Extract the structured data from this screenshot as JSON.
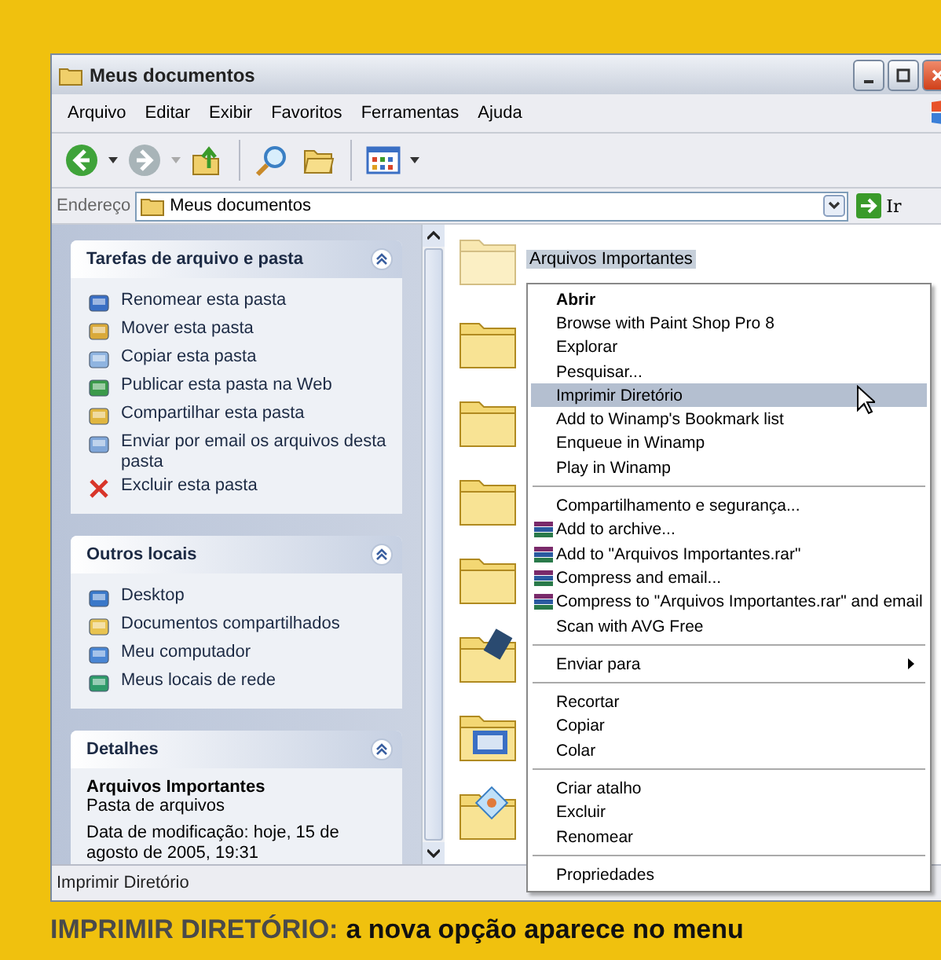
{
  "window": {
    "title": "Meus documentos"
  },
  "menu_bar": [
    "Arquivo",
    "Editar",
    "Exibir",
    "Favoritos",
    "Ferramentas",
    "Ajuda"
  ],
  "address_bar": {
    "label": "Endereço",
    "value": "Meus documentos",
    "go_button": "Ir"
  },
  "task_panels": [
    {
      "title": "Tarefas de arquivo e pasta",
      "items": [
        {
          "label": "Renomear esta pasta",
          "kind": "rename"
        },
        {
          "label": "Mover esta pasta",
          "kind": "move"
        },
        {
          "label": "Copiar esta pasta",
          "kind": "copy"
        },
        {
          "label": "Publicar esta pasta na Web",
          "kind": "globe"
        },
        {
          "label": "Compartilhar esta pasta",
          "kind": "share"
        },
        {
          "label": "Enviar por email os arquivos desta pasta",
          "kind": "mail"
        },
        {
          "label": "Excluir esta pasta",
          "kind": "delete"
        }
      ]
    },
    {
      "title": "Outros locais",
      "items": [
        {
          "label": "Desktop",
          "kind": "desktop"
        },
        {
          "label": "Documentos compartilhados",
          "kind": "folder"
        },
        {
          "label": "Meu computador",
          "kind": "computer"
        },
        {
          "label": "Meus locais de rede",
          "kind": "network"
        }
      ]
    },
    {
      "title": "Detalhes",
      "name": "Arquivos Importantes",
      "type": "Pasta de arquivos",
      "modified": "Data de modificação: hoje, 15 de agosto de 2005, 19:31"
    }
  ],
  "folders": [
    {
      "label": "Arquivos Importantes",
      "selected": true,
      "kind": "plain"
    },
    {
      "selected": false,
      "kind": "plain"
    },
    {
      "selected": false,
      "kind": "plain"
    },
    {
      "selected": false,
      "kind": "plain"
    },
    {
      "selected": false,
      "kind": "plain"
    },
    {
      "selected": false,
      "kind": "video"
    },
    {
      "selected": false,
      "kind": "program"
    },
    {
      "selected": false,
      "kind": "picture"
    }
  ],
  "context_menu": [
    [
      {
        "label": "Abrir",
        "kind": "default",
        "selected": false
      },
      {
        "label": "Browse with Paint Shop Pro 8",
        "kind": "item",
        "selected": false
      },
      {
        "label": "Explorar",
        "kind": "item",
        "selected": false
      },
      {
        "label": "Pesquisar...",
        "kind": "item",
        "selected": false
      },
      {
        "label": "Imprimir Diretório",
        "kind": "item",
        "selected": true
      },
      {
        "label": "Add to Winamp's Bookmark list",
        "kind": "item",
        "selected": false
      },
      {
        "label": "Enqueue in Winamp",
        "kind": "item",
        "selected": false
      },
      {
        "label": "Play in Winamp",
        "kind": "item",
        "selected": false
      }
    ],
    [
      {
        "label": "Compartilhamento e segurança...",
        "kind": "item",
        "selected": false
      },
      {
        "label": "Add to archive...",
        "kind": "archive",
        "selected": false
      },
      {
        "label": "Add to \"Arquivos Importantes.rar\"",
        "kind": "archive",
        "selected": false
      },
      {
        "label": "Compress and email...",
        "kind": "archive",
        "selected": false
      },
      {
        "label": "Compress to \"Arquivos Importantes.rar\" and email",
        "kind": "archive",
        "selected": false
      },
      {
        "label": "Scan with AVG Free",
        "kind": "item",
        "selected": false
      }
    ],
    [
      {
        "label": "Enviar para",
        "kind": "submenu",
        "selected": false
      }
    ],
    [
      {
        "label": "Recortar",
        "kind": "item",
        "selected": false
      },
      {
        "label": "Copiar",
        "kind": "item",
        "selected": false
      },
      {
        "label": "Colar",
        "kind": "item",
        "selected": false
      }
    ],
    [
      {
        "label": "Criar atalho",
        "kind": "item",
        "selected": false
      },
      {
        "label": "Excluir",
        "kind": "item",
        "selected": false
      },
      {
        "label": "Renomear",
        "kind": "item",
        "selected": false
      }
    ],
    [
      {
        "label": "Propriedades",
        "kind": "item",
        "selected": false
      }
    ]
  ],
  "status_bar": "Imprimir Diretório",
  "caption": {
    "label": "IMPRIMIR DIRETÓRIO:",
    "text": "a nova opção aparece no menu"
  }
}
